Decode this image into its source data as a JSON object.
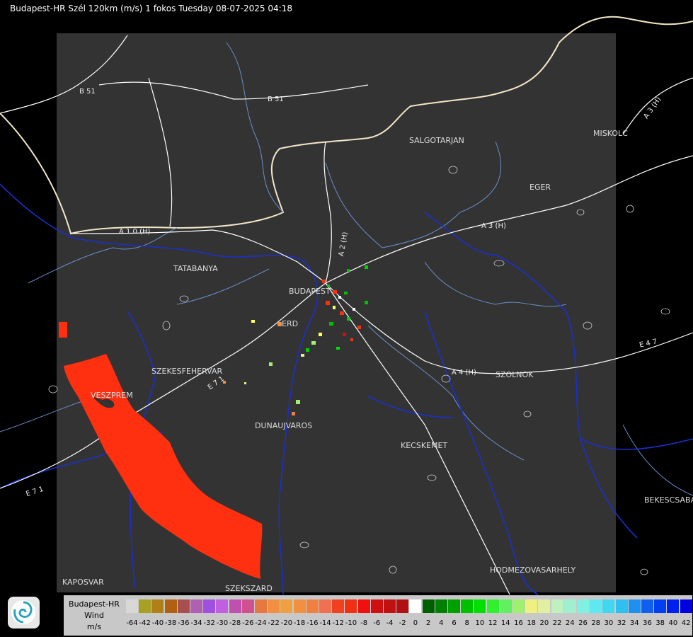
{
  "header": {
    "title": "Budapest-HR Szél 120km (m/s) 1 fokos Tuesday 08-07-2025 04:18"
  },
  "cities": [
    {
      "name": "SALGOTARJAN"
    },
    {
      "name": "MISKOLC"
    },
    {
      "name": "EGER"
    },
    {
      "name": "TATABANYA"
    },
    {
      "name": "BUDAPEST"
    },
    {
      "name": "ERD"
    },
    {
      "name": "SZEKESFEHERVAR"
    },
    {
      "name": "VESZPREM"
    },
    {
      "name": "DUNAUJVAROS"
    },
    {
      "name": "KECSKEMET"
    },
    {
      "name": "SZOLNOK"
    },
    {
      "name": "BEKESCSABA"
    },
    {
      "name": "HODMEZOVASARHELY"
    },
    {
      "name": "KAPOSVAR"
    },
    {
      "name": "SZEKSZARD"
    }
  ],
  "roads": [
    {
      "label": "B 51"
    },
    {
      "label": "B 51"
    },
    {
      "label": "A 3 (H)"
    },
    {
      "label": "A 3 (H)"
    },
    {
      "label": "A 1 0 (H)"
    },
    {
      "label": "A 2 (H)"
    },
    {
      "label": "A 4 (H)"
    },
    {
      "label": "E 4 7"
    },
    {
      "label": "E 7 1"
    },
    {
      "label": "E 7 1"
    }
  ],
  "legend": {
    "line1": "Budapest-HR",
    "line2": "Wind",
    "line3": "m/s",
    "scale": [
      {
        "value": "-64",
        "color": "#d8d8d8"
      },
      {
        "value": "-42",
        "color": "#a8a020"
      },
      {
        "value": "-40",
        "color": "#b08018"
      },
      {
        "value": "-38",
        "color": "#b06010"
      },
      {
        "value": "-36",
        "color": "#a85050"
      },
      {
        "value": "-34",
        "color": "#b060b0"
      },
      {
        "value": "-32",
        "color": "#a050e0"
      },
      {
        "value": "-30",
        "color": "#c060e0"
      },
      {
        "value": "-28",
        "color": "#c050b0"
      },
      {
        "value": "-26",
        "color": "#d05090"
      },
      {
        "value": "-24",
        "color": "#e87840"
      },
      {
        "value": "-22",
        "color": "#f09040"
      },
      {
        "value": "-20",
        "color": "#f0a040"
      },
      {
        "value": "-18",
        "color": "#f09040"
      },
      {
        "value": "-16",
        "color": "#f08040"
      },
      {
        "value": "-14",
        "color": "#f07050"
      },
      {
        "value": "-12",
        "color": "#f04020"
      },
      {
        "value": "-10",
        "color": "#f03010"
      },
      {
        "value": "-8",
        "color": "#f01010"
      },
      {
        "value": "-6",
        "color": "#d01010"
      },
      {
        "value": "-4",
        "color": "#c01010"
      },
      {
        "value": "-2",
        "color": "#b01010"
      },
      {
        "value": "0",
        "color": "#ffffff"
      },
      {
        "value": "2",
        "color": "#006000"
      },
      {
        "value": "4",
        "color": "#008000"
      },
      {
        "value": "6",
        "color": "#00a000"
      },
      {
        "value": "8",
        "color": "#00c000"
      },
      {
        "value": "10",
        "color": "#00e000"
      },
      {
        "value": "12",
        "color": "#30f030"
      },
      {
        "value": "14",
        "color": "#60f060"
      },
      {
        "value": "16",
        "color": "#a0f070"
      },
      {
        "value": "18",
        "color": "#f0f080"
      },
      {
        "value": "20",
        "color": "#e0f0a0"
      },
      {
        "value": "22",
        "color": "#c0f0c0"
      },
      {
        "value": "24",
        "color": "#a0f0d0"
      },
      {
        "value": "26",
        "color": "#80f0e0"
      },
      {
        "value": "28",
        "color": "#60e8f0"
      },
      {
        "value": "30",
        "color": "#40d8f0"
      },
      {
        "value": "32",
        "color": "#30c0f0"
      },
      {
        "value": "34",
        "color": "#2090f0"
      },
      {
        "value": "36",
        "color": "#1060f0"
      },
      {
        "value": "38",
        "color": "#0040f0"
      },
      {
        "value": "40",
        "color": "#0020f0"
      },
      {
        "value": "42",
        "color": "#0000e0"
      }
    ]
  },
  "colors": {
    "background": "#000000",
    "radar_area": "#333333",
    "rivers": "#1a2fcc",
    "borders": "#6a8fcc",
    "roads": "#ffffff",
    "echo_main": "#ff3010"
  }
}
